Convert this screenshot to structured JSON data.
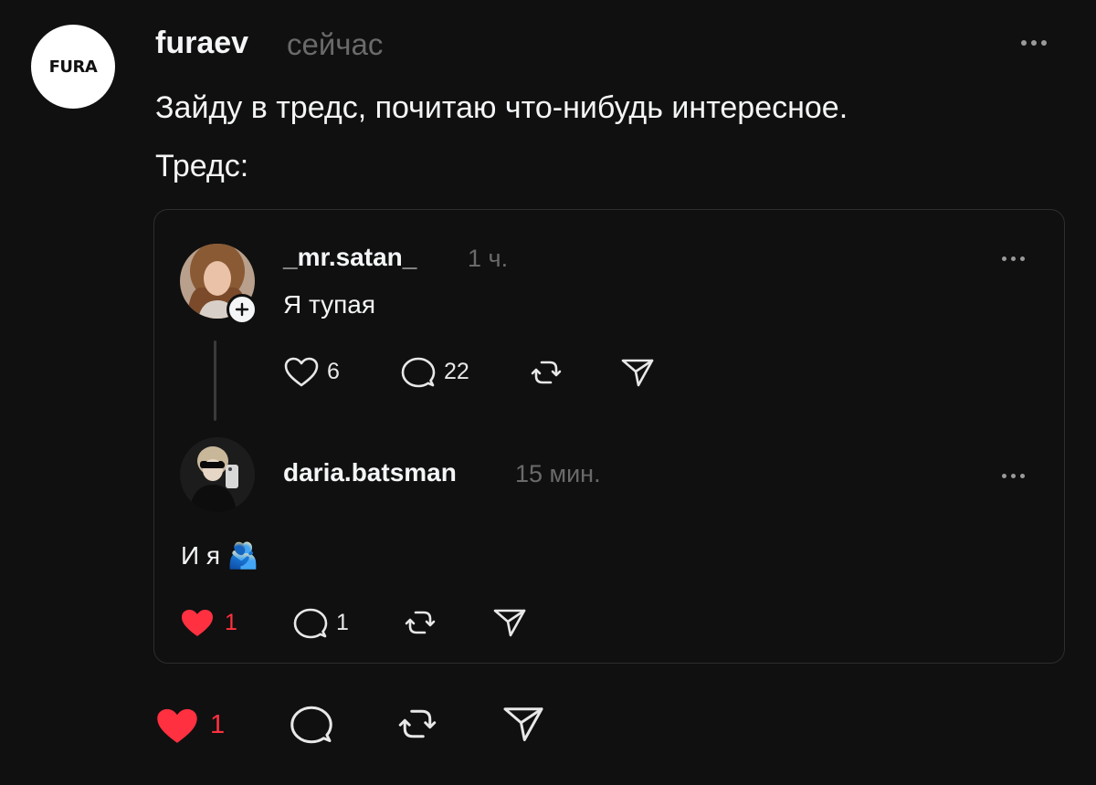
{
  "post": {
    "avatar_text": "FURA",
    "username": "furaev",
    "time": "сейчас",
    "text_line1": "Зайду в тредс, почитаю что-нибудь интересное.",
    "text_line2": "Тредс:",
    "actions": {
      "like_count": "1"
    },
    "colors": {
      "like": "#ff3040",
      "muted": "#6a6a6a",
      "background": "#101010"
    }
  },
  "quote": {
    "first": {
      "username": "_mr.satan_",
      "time": "1 ч.",
      "text": "Я тупая",
      "like_count": "6",
      "reply_count": "22"
    },
    "reply": {
      "username": "daria.batsman",
      "time": "15 мин.",
      "text": "И я",
      "emoji": "🫂",
      "like_count": "1",
      "reply_count": "1"
    }
  }
}
